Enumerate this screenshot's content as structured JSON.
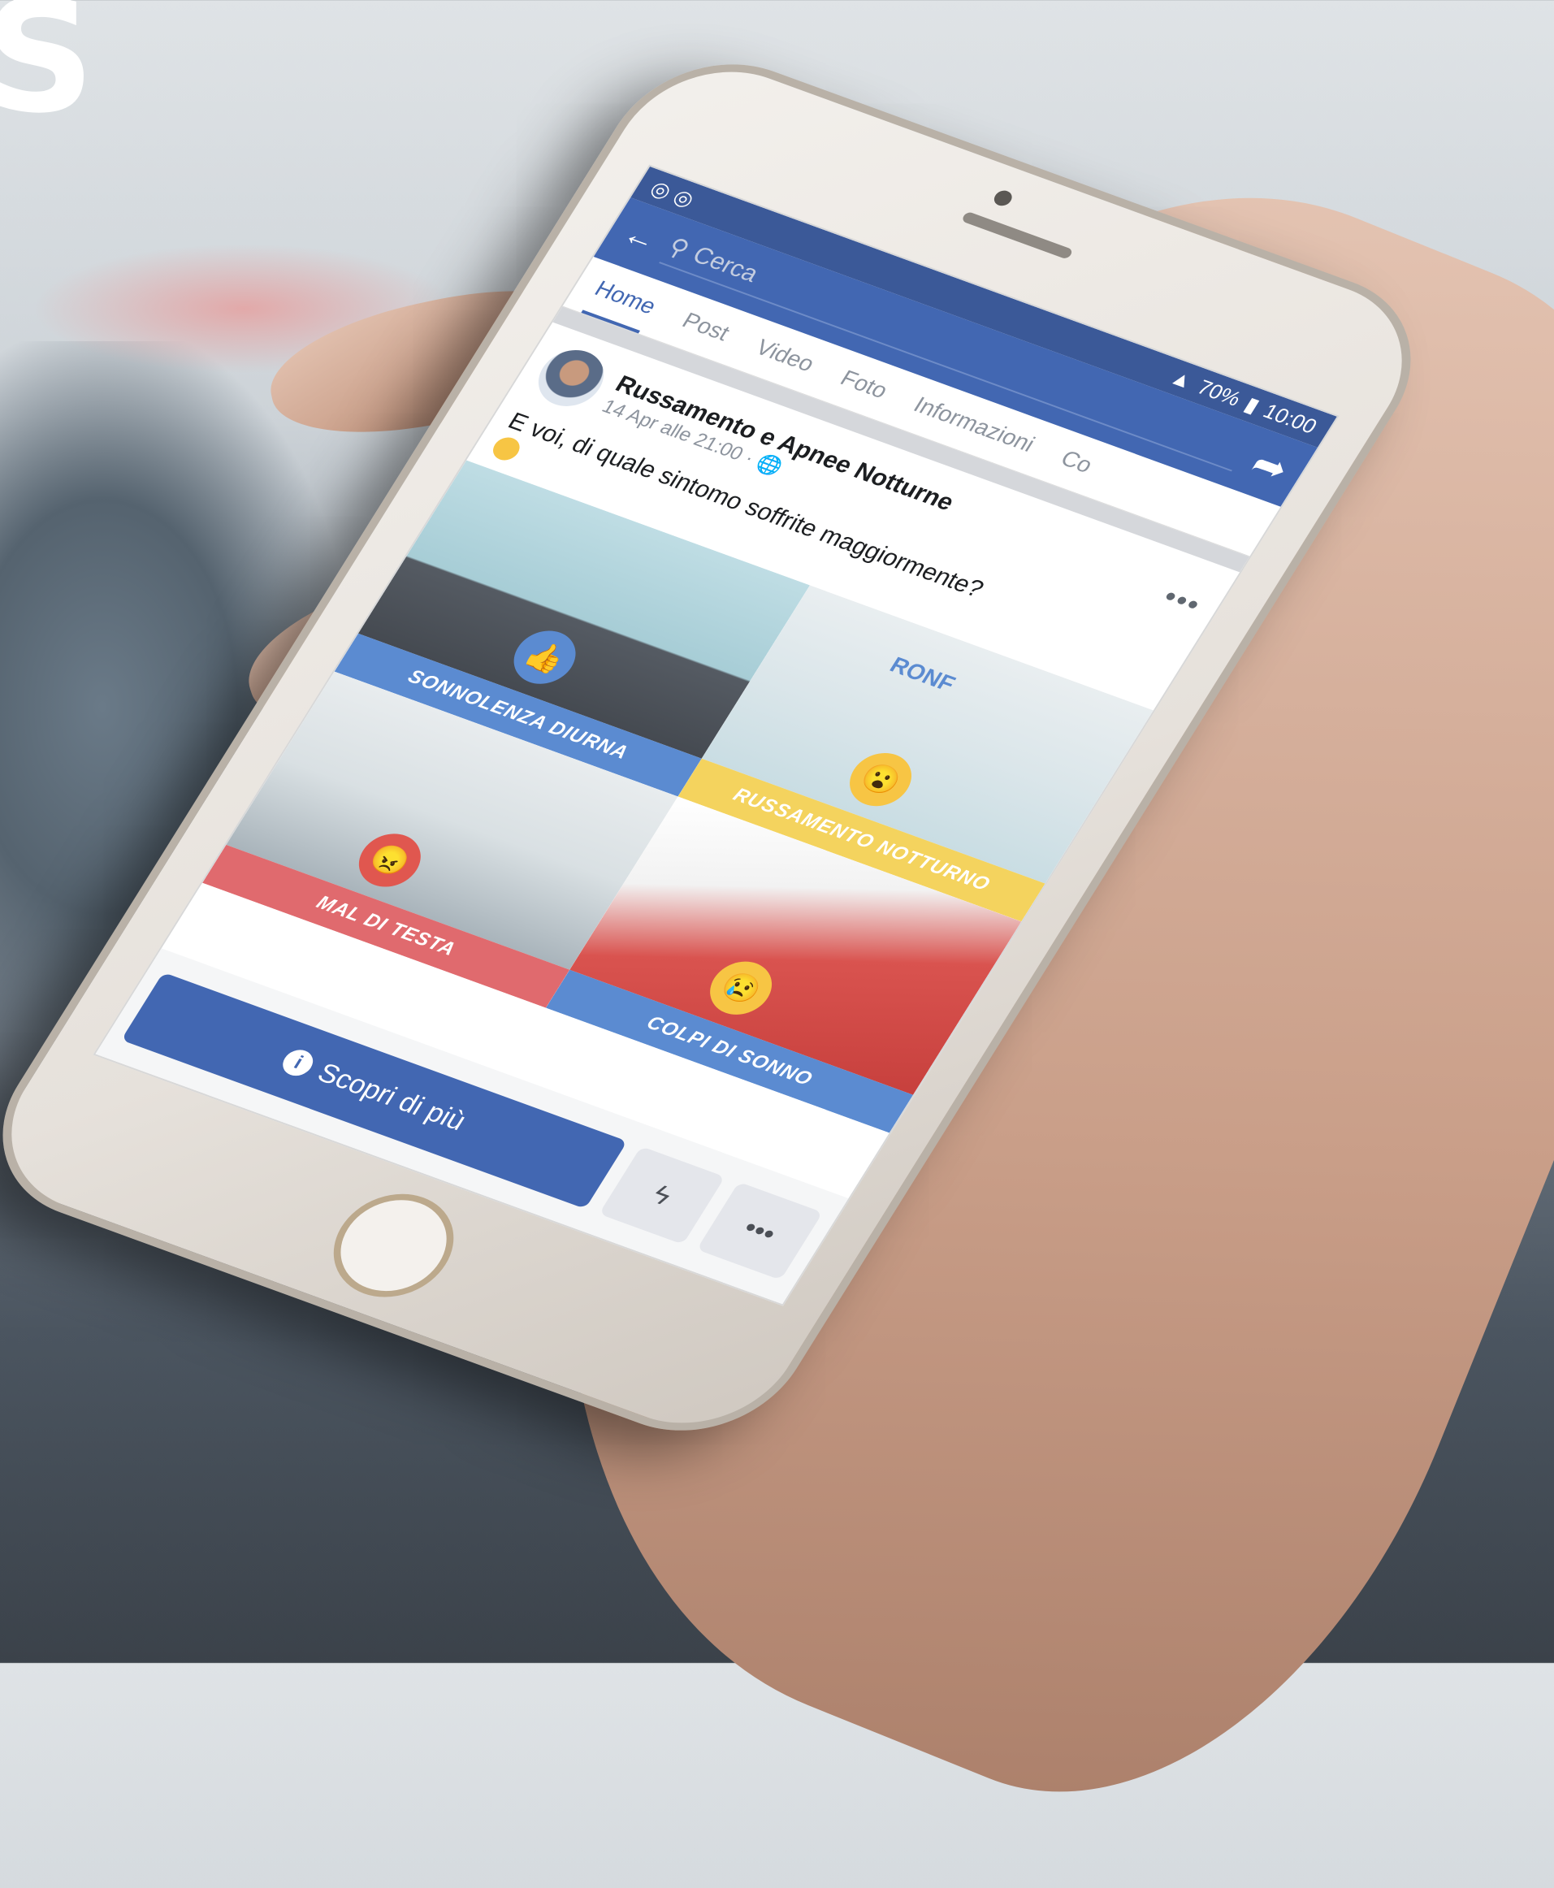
{
  "status_bar": {
    "battery": "70%",
    "time": "10:00"
  },
  "navbar": {
    "search_placeholder": "Cerca"
  },
  "tabs": [
    {
      "label": "Home",
      "active": true
    },
    {
      "label": "Post"
    },
    {
      "label": "Video"
    },
    {
      "label": "Foto"
    },
    {
      "label": "Informazioni"
    },
    {
      "label": "Co"
    }
  ],
  "post": {
    "page_name": "Russamento e Apnee Notturne",
    "date": "14 Apr alle 21:00 ·",
    "text": "E voi, di quale sintomo soffrite maggiormente?",
    "panels": [
      {
        "label": "SONNOLENZA DIURNA",
        "reaction": "like",
        "caption_color": "#5b8bd1"
      },
      {
        "label": "RUSSAMENTO NOTTURNO",
        "reaction": "wow",
        "art_text": "RONF",
        "caption_color": "#f4d35e"
      },
      {
        "label": "MAL DI TESTA",
        "reaction": "angry",
        "caption_color": "#e06a6e"
      },
      {
        "label": "COLPI DI SONNO",
        "reaction": "sad",
        "caption_color": "#5b8bd1"
      }
    ]
  },
  "bottom": {
    "cta_label": "Scopri di più"
  },
  "colors": {
    "facebook_blue": "#4267b2",
    "status_bar": "#3b5998"
  }
}
